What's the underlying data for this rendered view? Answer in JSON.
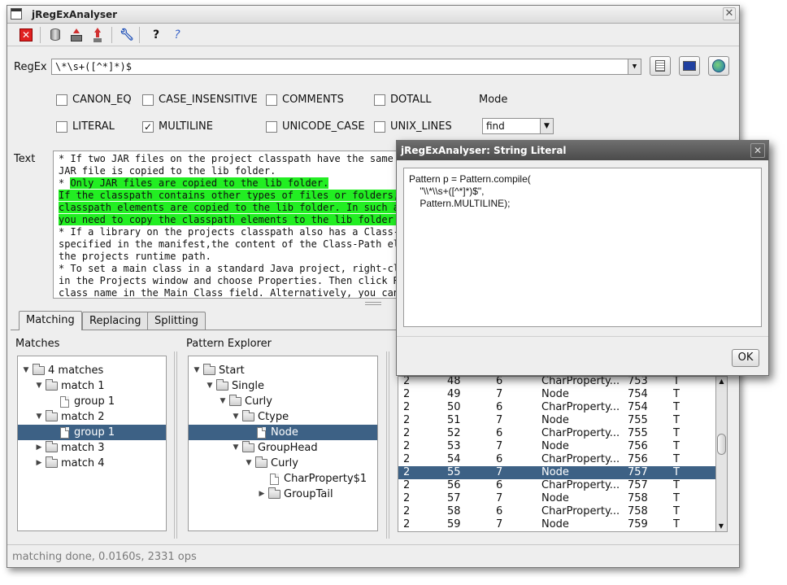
{
  "app": {
    "title": "jRegExAnalyser",
    "toolbar": {
      "icons": [
        "stop-icon",
        "database-icon",
        "export-icon",
        "upload-icon",
        "wrench-icon",
        "help-icon",
        "about-icon"
      ],
      "help_glyph": "?",
      "about_glyph": "?"
    },
    "regex": {
      "label": "RegEx",
      "value": "\\*\\s+([^*]*)$",
      "side_buttons": [
        "copy-literal-icon",
        "network-icon",
        "globe-icon"
      ]
    },
    "flags": [
      {
        "label": "CANON_EQ",
        "checked": false
      },
      {
        "label": "CASE_INSENSITIVE",
        "checked": false
      },
      {
        "label": "COMMENTS",
        "checked": false
      },
      {
        "label": "DOTALL",
        "checked": false
      },
      {
        "label": "LITERAL",
        "checked": false
      },
      {
        "label": "MULTILINE",
        "checked": true
      },
      {
        "label": "UNICODE_CASE",
        "checked": false
      },
      {
        "label": "UNIX_LINES",
        "checked": false
      }
    ],
    "mode": {
      "label": "Mode",
      "value": "find"
    },
    "text": {
      "label": "Text",
      "lines": [
        {
          "t": "* If two JAR files on the project classpath have the same na",
          "hl": false
        },
        {
          "t": "JAR file is copied to the lib folder.",
          "hl": false
        },
        {
          "t": "* ",
          "hl2": "Only JAR files are copied to the lib folder.",
          "hl": "partial"
        },
        {
          "t": "If the classpath contains other types of files or folders, t",
          "hl": true
        },
        {
          "t": "classpath elements are copied to the lib folder. In such a c",
          "hl": true
        },
        {
          "t": "you need to copy the classpath elements to the lib folder ma",
          "hl": true
        },
        {
          "t": "* If a library on the projects classpath also has a Class-Pa",
          "hl": false
        },
        {
          "t": "specified in the manifest,the content of the Class-Path elem",
          "hl": false
        },
        {
          "t": "the projects runtime path.",
          "hl": false
        },
        {
          "t": "* To set a main class in a standard Java project, right-clic",
          "hl": false
        },
        {
          "t": "in the Projects window and choose Properties. Then click Run",
          "hl": false
        },
        {
          "t": "class name in the Main Class field. Alternatively, you can r",
          "hl": false
        }
      ]
    },
    "tabs": [
      "Matching",
      "Replacing",
      "Splitting"
    ],
    "matches": {
      "label": "Matches",
      "rows": [
        {
          "text": "4 matches",
          "kind": "folder",
          "twisty": "▼",
          "indent": 0
        },
        {
          "text": "match 1",
          "kind": "folder",
          "twisty": "▼",
          "indent": 1
        },
        {
          "text": "group 1",
          "kind": "doc",
          "twisty": "",
          "indent": 2
        },
        {
          "text": "match 2",
          "kind": "folder",
          "twisty": "▼",
          "indent": 1
        },
        {
          "text": "group 1",
          "kind": "doc",
          "twisty": "",
          "indent": 2,
          "selected": true
        },
        {
          "text": "match 3",
          "kind": "folder",
          "twisty": "▶",
          "indent": 1
        },
        {
          "text": "match 4",
          "kind": "folder",
          "twisty": "▶",
          "indent": 1
        }
      ]
    },
    "pattern_explorer": {
      "label": "Pattern Explorer",
      "rows": [
        {
          "text": "Start",
          "kind": "folder",
          "twisty": "▼",
          "indent": 0
        },
        {
          "text": "Single",
          "kind": "folder",
          "twisty": "▼",
          "indent": 1
        },
        {
          "text": "Curly",
          "kind": "folder",
          "twisty": "▼",
          "indent": 2
        },
        {
          "text": "Ctype",
          "kind": "folder",
          "twisty": "▼",
          "indent": 3
        },
        {
          "text": "Node",
          "kind": "doc",
          "twisty": "",
          "indent": 4,
          "selected": true
        },
        {
          "text": "GroupHead",
          "kind": "folder",
          "twisty": "▼",
          "indent": 3
        },
        {
          "text": "Curly",
          "kind": "folder",
          "twisty": "▼",
          "indent": 4
        },
        {
          "text": "CharProperty$1",
          "kind": "doc",
          "twisty": "",
          "indent": 5
        },
        {
          "text": "GroupTail",
          "kind": "folder",
          "twisty": "▶",
          "indent": 5
        }
      ]
    },
    "match_table": {
      "rows": [
        [
          "2",
          "48",
          "6",
          "CharProperty...",
          "753",
          "T"
        ],
        [
          "2",
          "49",
          "7",
          "Node",
          "754",
          "T"
        ],
        [
          "2",
          "50",
          "6",
          "CharProperty...",
          "754",
          "T"
        ],
        [
          "2",
          "51",
          "7",
          "Node",
          "755",
          "T"
        ],
        [
          "2",
          "52",
          "6",
          "CharProperty...",
          "755",
          "T"
        ],
        [
          "2",
          "53",
          "7",
          "Node",
          "756",
          "T"
        ],
        [
          "2",
          "54",
          "6",
          "CharProperty...",
          "756",
          "T"
        ],
        [
          "2",
          "55",
          "7",
          "Node",
          "757",
          "T"
        ],
        [
          "2",
          "56",
          "6",
          "CharProperty...",
          "757",
          "T"
        ],
        [
          "2",
          "57",
          "7",
          "Node",
          "758",
          "T"
        ],
        [
          "2",
          "58",
          "6",
          "CharProperty...",
          "758",
          "T"
        ],
        [
          "2",
          "59",
          "7",
          "Node",
          "759",
          "T"
        ]
      ],
      "selected_index": 7
    },
    "status": "matching done, 0.0160s, 2331 ops"
  },
  "dialog": {
    "title": "jRegExAnalyser: String Literal",
    "code_lines": [
      "Pattern p = Pattern.compile(",
      "    \"\\\\*\\\\s+([^*]*)$\",",
      "    Pattern.MULTILINE);"
    ],
    "ok_label": "OK"
  },
  "colors": {
    "selection": "#3d6185",
    "highlight": "#22ee22"
  }
}
